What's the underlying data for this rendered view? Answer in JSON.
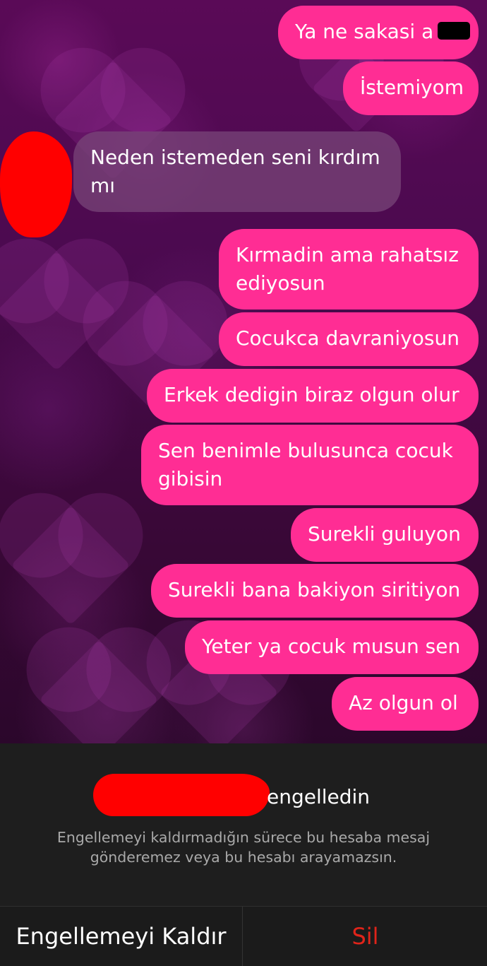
{
  "messages": [
    {
      "text": "Ya ne sakasi a",
      "from": "me"
    },
    {
      "text": "İstemiyom",
      "from": "me"
    },
    {
      "text": "Neden istemeden seni kırdım mı",
      "from": "them"
    },
    {
      "text": "Kırmadin ama rahatsız ediyosun",
      "from": "me"
    },
    {
      "text": "Cocukca davraniyosun",
      "from": "me"
    },
    {
      "text": "Erkek dedigin biraz olgun olur",
      "from": "me"
    },
    {
      "text": "Sen benimle bulusunca cocuk gibisin",
      "from": "me"
    },
    {
      "text": "Surekli guluyon",
      "from": "me"
    },
    {
      "text": "Surekli bana bakiyon siritiyon",
      "from": "me"
    },
    {
      "text": "Yeter ya cocuk musun sen",
      "from": "me"
    },
    {
      "text": "Az olgun ol",
      "from": "me"
    }
  ],
  "block_notice": {
    "title_suffix": "engelledin",
    "description": "Engellemeyi kaldırmadığın sürece bu hesaba mesaj gönderemez veya bu hesabı arayamazsın."
  },
  "actions": {
    "unblock_label": "Engellemeyi Kaldır",
    "delete_label": "Sil"
  },
  "colors": {
    "sent_bubble": "#ff2d94",
    "received_bubble": "#784678",
    "delete_text": "#e0241a"
  }
}
